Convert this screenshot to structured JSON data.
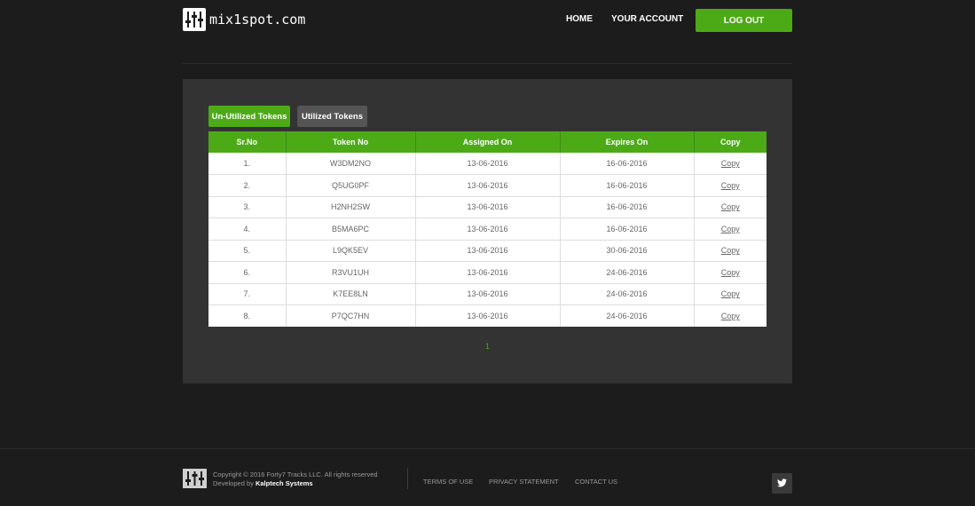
{
  "header": {
    "logo_text": "mix1spot.com",
    "nav": {
      "home": "HOME",
      "account": "YOUR ACCOUNT"
    },
    "logout": "LOG OUT"
  },
  "tabs": {
    "unutilized": "Un-Utilized Tokens",
    "utilized": "Utilized Tokens"
  },
  "table": {
    "headers": [
      "Sr.No",
      "Token No",
      "Assigned On",
      "Expires On",
      "Copy"
    ],
    "rows": [
      {
        "sr": "1.",
        "token": "W3DM2NO",
        "assigned": "13-06-2016",
        "expires": "16-06-2016",
        "copy": "Copy"
      },
      {
        "sr": "2.",
        "token": "Q5UG0PF",
        "assigned": "13-06-2016",
        "expires": "16-06-2016",
        "copy": "Copy"
      },
      {
        "sr": "3.",
        "token": "H2NH2SW",
        "assigned": "13-06-2016",
        "expires": "16-06-2016",
        "copy": "Copy"
      },
      {
        "sr": "4.",
        "token": "B5MA6PC",
        "assigned": "13-06-2016",
        "expires": "16-06-2016",
        "copy": "Copy"
      },
      {
        "sr": "5.",
        "token": "L9QK5EV",
        "assigned": "13-06-2016",
        "expires": "30-06-2016",
        "copy": "Copy"
      },
      {
        "sr": "6.",
        "token": "R3VU1UH",
        "assigned": "13-06-2016",
        "expires": "24-06-2016",
        "copy": "Copy"
      },
      {
        "sr": "7.",
        "token": "K7EE8LN",
        "assigned": "13-06-2016",
        "expires": "24-06-2016",
        "copy": "Copy"
      },
      {
        "sr": "8.",
        "token": "P7QC7HN",
        "assigned": "13-06-2016",
        "expires": "24-06-2016",
        "copy": "Copy"
      }
    ]
  },
  "pagination": {
    "current": "1"
  },
  "footer": {
    "copyright": "Copyright © 2016 Forty7 Tracks LLC. All rights reserved",
    "developed_prefix": "Developed by",
    "developer": "Kalptech Systems",
    "links": {
      "terms": "TERMS OF USE",
      "privacy": "PRIVACY STATEMENT",
      "contact": "CONTACT US"
    }
  },
  "colors": {
    "accent": "#4caa17",
    "background": "#1c1c1c",
    "panel": "#333333"
  },
  "icons": {
    "logo": "mixer-sliders-icon",
    "twitter": "twitter-icon"
  }
}
